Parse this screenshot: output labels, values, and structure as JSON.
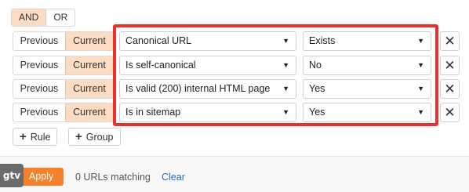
{
  "logic": {
    "and_label": "AND",
    "or_label": "OR",
    "active": "AND"
  },
  "rules": [
    {
      "previous_label": "Previous",
      "current_label": "Current",
      "field": "Canonical URL",
      "operator": "Exists"
    },
    {
      "previous_label": "Previous",
      "current_label": "Current",
      "field": "Is self-canonical",
      "operator": "No"
    },
    {
      "previous_label": "Previous",
      "current_label": "Current",
      "field": "Is valid (200) internal HTML page",
      "operator": "Yes"
    },
    {
      "previous_label": "Previous",
      "current_label": "Current",
      "field": "Is in sitemap",
      "operator": "Yes"
    }
  ],
  "actions": {
    "add_rule": "Rule",
    "add_group": "Group"
  },
  "footer": {
    "apply": "Apply",
    "match_count": "0 URLs matching",
    "clear": "Clear"
  },
  "logo": {
    "text": "gtv"
  },
  "colors": {
    "accent": "#f5822a",
    "selected_segment": "#fcdcc2",
    "highlight_border": "#e8302c",
    "link": "#2a6fb7"
  }
}
